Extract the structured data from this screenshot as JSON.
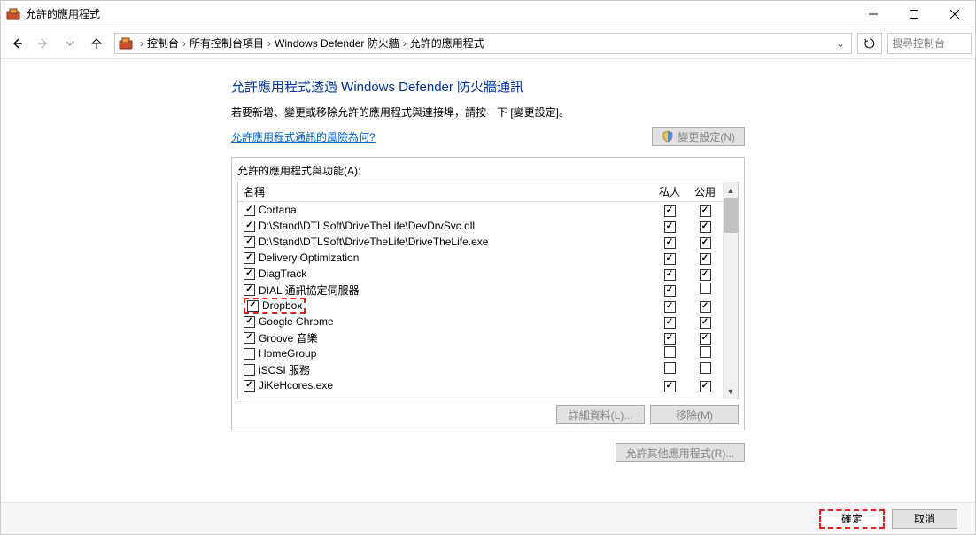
{
  "window": {
    "title": "允許的應用程式"
  },
  "nav": {
    "breadcrumbs": [
      "控制台",
      "所有控制台項目",
      "Windows Defender 防火牆",
      "允許的應用程式"
    ],
    "search_placeholder": "搜尋控制台"
  },
  "page": {
    "heading": "允許應用程式透過 Windows Defender 防火牆通訊",
    "subtitle": "若要新增、變更或移除允許的應用程式與連接埠，請按一下 [變更設定]。",
    "risk_link": "允許應用程式通訊的風險為何?",
    "change_settings_btn": "變更設定(N)"
  },
  "listbox": {
    "label": "允許的應用程式與功能(A):",
    "col_name": "名稱",
    "col_private": "私人",
    "col_public": "公用",
    "rows": [
      {
        "enabled": true,
        "name": "Cortana",
        "priv": true,
        "pub": true,
        "highlight": false
      },
      {
        "enabled": true,
        "name": "D:\\Stand\\DTLSoft\\DriveTheLife\\DevDrvSvc.dll",
        "priv": true,
        "pub": true,
        "highlight": false
      },
      {
        "enabled": true,
        "name": "D:\\Stand\\DTLSoft\\DriveTheLife\\DriveTheLife.exe",
        "priv": true,
        "pub": true,
        "highlight": false
      },
      {
        "enabled": true,
        "name": "Delivery Optimization",
        "priv": true,
        "pub": true,
        "highlight": false
      },
      {
        "enabled": true,
        "name": "DiagTrack",
        "priv": true,
        "pub": true,
        "highlight": false
      },
      {
        "enabled": true,
        "name": "DIAL 通訊協定伺服器",
        "priv": true,
        "pub": false,
        "highlight": false
      },
      {
        "enabled": true,
        "name": "Dropbox",
        "priv": true,
        "pub": true,
        "highlight": true
      },
      {
        "enabled": true,
        "name": "Google Chrome",
        "priv": true,
        "pub": true,
        "highlight": false
      },
      {
        "enabled": true,
        "name": "Groove 音樂",
        "priv": true,
        "pub": true,
        "highlight": false
      },
      {
        "enabled": false,
        "name": "HomeGroup",
        "priv": false,
        "pub": false,
        "highlight": false
      },
      {
        "enabled": false,
        "name": "iSCSI 服務",
        "priv": false,
        "pub": false,
        "highlight": false
      },
      {
        "enabled": true,
        "name": "JiKeHcores.exe",
        "priv": true,
        "pub": true,
        "highlight": false
      }
    ],
    "details_btn": "詳細資料(L)...",
    "remove_btn": "移除(M)",
    "allow_another_btn": "允許其他應用程式(R)..."
  },
  "footer": {
    "ok": "確定",
    "cancel": "取消"
  }
}
